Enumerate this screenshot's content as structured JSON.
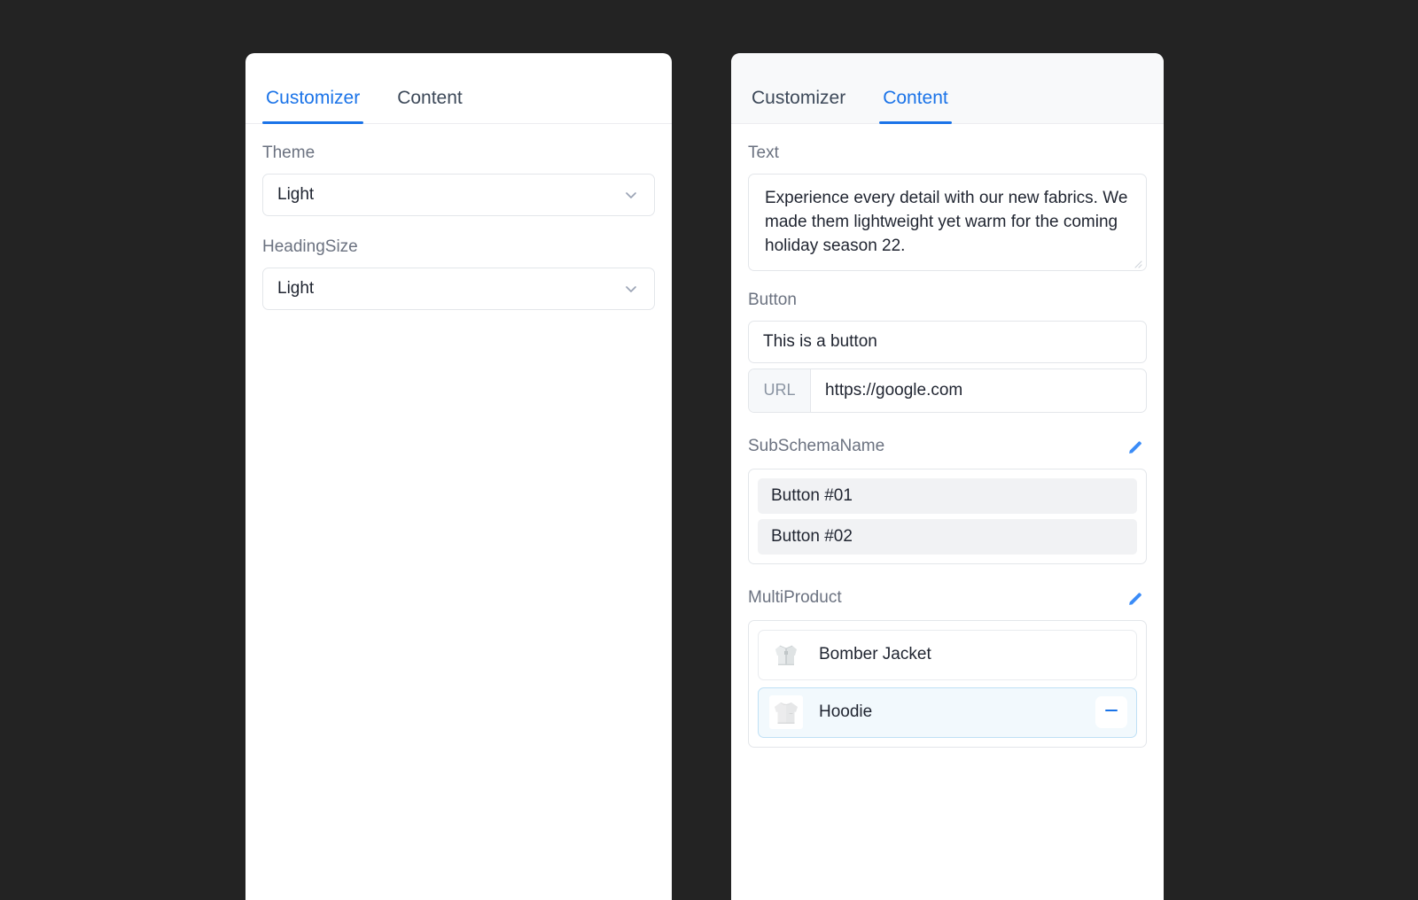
{
  "colors": {
    "background": "#232323",
    "accent": "#1a73e8",
    "panel": "#ffffff",
    "header_shade": "#f8f9fa",
    "label": "#6b7280",
    "selected_row_bg": "#f2f9fd",
    "selected_row_border": "#bfe0f5",
    "chip_bg": "#f1f2f4"
  },
  "left_panel": {
    "tabs": [
      {
        "label": "Customizer",
        "active": true
      },
      {
        "label": "Content",
        "active": false
      }
    ],
    "fields": [
      {
        "label": "Theme",
        "value": "Light",
        "icon": "chevron-down-icon"
      },
      {
        "label": "HeadingSize",
        "value": "Light",
        "icon": "chevron-down-icon"
      }
    ]
  },
  "right_panel": {
    "tabs": [
      {
        "label": "Customizer",
        "active": false
      },
      {
        "label": "Content",
        "active": true
      }
    ],
    "text_field": {
      "label": "Text",
      "value": "Experience every detail with our new fabrics. We made them lightweight yet warm for the coming holiday season 22.",
      "placeholder": "",
      "resize_handle_icon": "resize-handle-icon"
    },
    "button_field": {
      "label": "Button",
      "value": "This is a button",
      "placeholder": "",
      "url_prefix": "URL",
      "url_value": "https://google.com",
      "url_placeholder": ""
    },
    "sub_schema": {
      "label": "SubSchemaName",
      "edit_icon": "pencil-icon",
      "items": [
        {
          "label": "Button #01"
        },
        {
          "label": "Button #02"
        }
      ]
    },
    "multi_product": {
      "label": "MultiProduct",
      "edit_icon": "pencil-icon",
      "items": [
        {
          "name": "Bomber Jacket",
          "thumb": "bomber-jacket-thumbnail",
          "selected": false,
          "action_icon": ""
        },
        {
          "name": "Hoodie",
          "thumb": "hoodie-thumbnail",
          "selected": true,
          "action_icon": "minus-icon"
        }
      ]
    }
  }
}
